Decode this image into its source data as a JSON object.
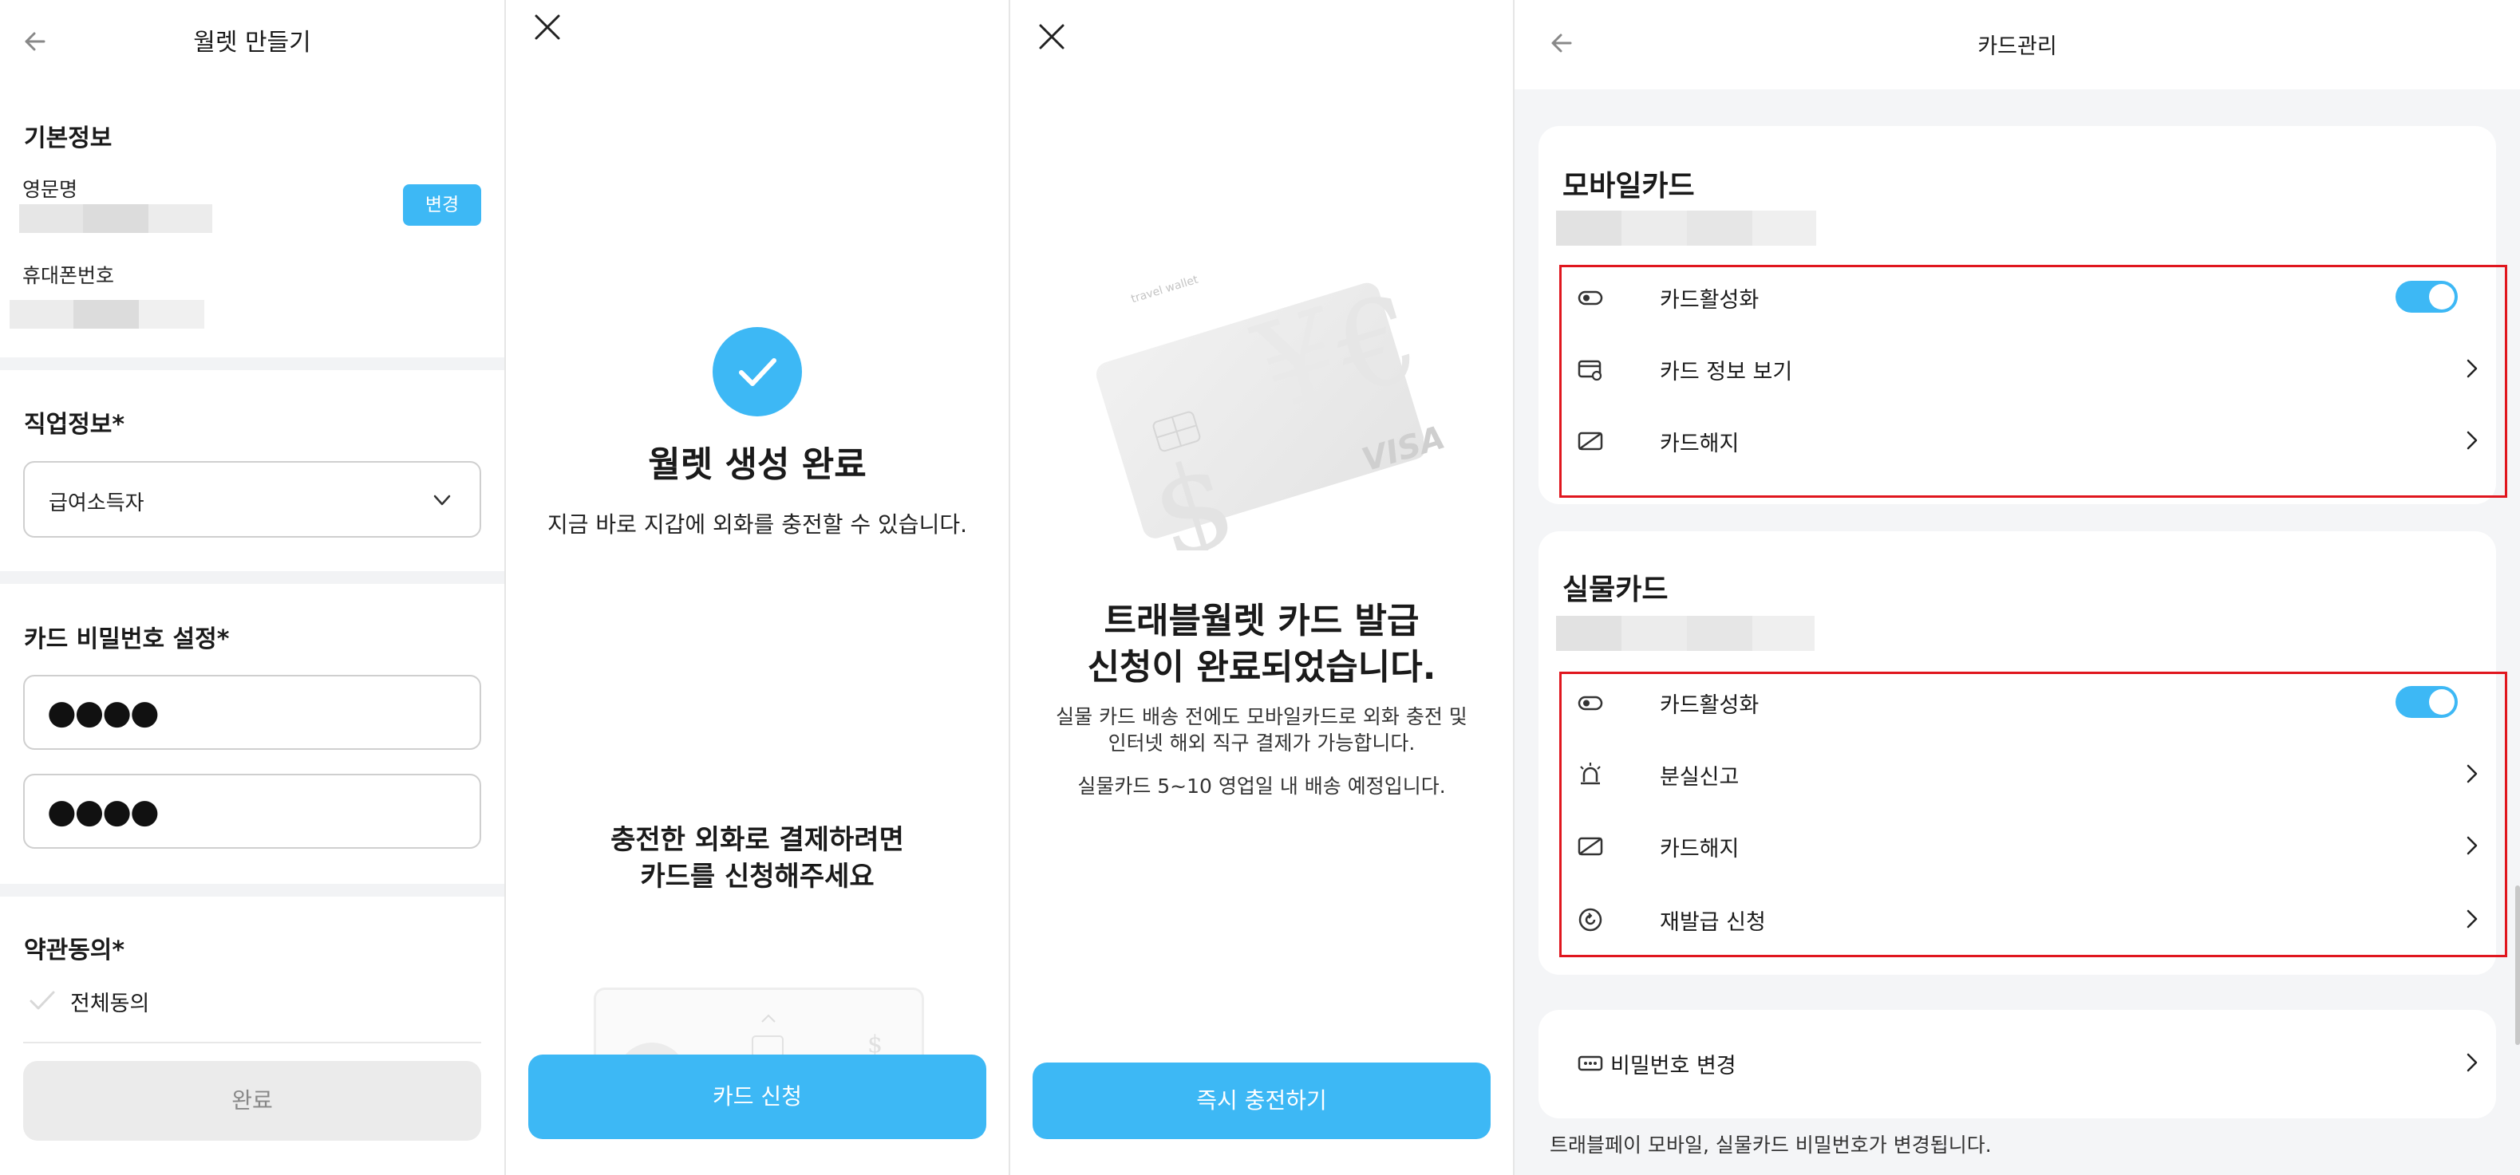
{
  "accent_color": "#3db8f5",
  "wallet_create": {
    "title": "월렛 만들기",
    "basic_info_title": "기본정보",
    "english_name_label": "영문명",
    "change_button": "변경",
    "phone_label": "휴대폰번호",
    "job_info_title": "직업정보*",
    "job_selected": "급여소득자",
    "card_pw_title": "카드 비밀번호 설정*",
    "pw_mask_1": "●●●●",
    "pw_mask_2": "●●●●",
    "terms_title": "약관동의*",
    "agree_all": "전체동의",
    "done_button": "완료"
  },
  "wallet_complete": {
    "title": "월렛 생성 완료",
    "subtitle": "지금 바로 지갑에 외화를 충전할 수 있습니다.",
    "prompt_line1": "충전한 외화로 결제하려면",
    "prompt_line2": "카드를 신청해주세요",
    "apply_button": "카드 신청"
  },
  "card_issued": {
    "card_brand": "VISA",
    "card_issuer_text": "travel wallet",
    "title_line1": "트래블월렛 카드 발급",
    "title_line2": "신청이 완료되었습니다.",
    "desc_line1": "실물 카드 배송 전에도 모바일카드로 외화 충전 및",
    "desc_line2": "인터넷 해외 직구 결제가 가능합니다.",
    "desc_line3": "실물카드 5~10 영업일 내 배송 예정입니다.",
    "charge_button": "즉시 충전하기"
  },
  "card_manage": {
    "title": "카드관리",
    "mobile_card": {
      "title": "모바일카드",
      "items": [
        {
          "label": "카드활성화",
          "icon": "toggle-icon",
          "type": "toggle",
          "on": true
        },
        {
          "label": "카드 정보 보기",
          "icon": "card-info-icon",
          "type": "link"
        },
        {
          "label": "카드해지",
          "icon": "card-cancel-icon",
          "type": "link"
        }
      ]
    },
    "physical_card": {
      "title": "실물카드",
      "items": [
        {
          "label": "카드활성화",
          "icon": "toggle-icon",
          "type": "toggle",
          "on": true
        },
        {
          "label": "분실신고",
          "icon": "siren-icon",
          "type": "link"
        },
        {
          "label": "카드해지",
          "icon": "card-cancel-icon",
          "type": "link"
        },
        {
          "label": "재발급 신청",
          "icon": "reissue-icon",
          "type": "link"
        }
      ]
    },
    "password_change": {
      "label": "비밀번호 변경",
      "icon": "dots-icon"
    },
    "footnote": "트래블페이 모바일, 실물카드 비밀번호가 변경됩니다."
  }
}
